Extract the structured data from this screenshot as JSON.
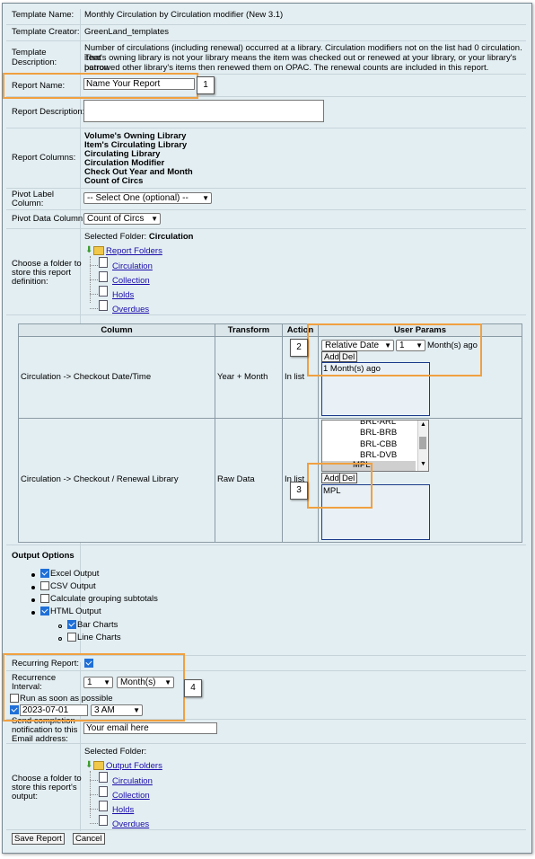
{
  "template_name": {
    "label": "Template Name:",
    "value": "Monthly Circulation by Circulation modifier (New 3.1)"
  },
  "template_creator": {
    "label": "Template Creator:",
    "value": "GreenLand_templates"
  },
  "template_description": {
    "label_line1": "Template",
    "label_line2": "Description:",
    "line1": "Number of circulations (including renewal) occurred at a library. Circulation modifiers not on the list had 0 circulation. That",
    "line2": "item's owning library is not your library means the item was checked out or renewed at your library, or your library's patron",
    "line3": "borrowed other library's items then renewed them on OPAC. The renewal counts are included in this report."
  },
  "report_name": {
    "label": "Report Name:",
    "value": "Name Your Report"
  },
  "report_description": {
    "label": "Report Description:"
  },
  "report_columns": {
    "label": "Report Columns:",
    "items": [
      "Volume's Owning Library",
      "Item's Circulating Library",
      "Circulating Library",
      "Circulation Modifier",
      "Check Out Year and Month",
      "Count of Circs"
    ]
  },
  "pivot_label": {
    "label_line1": "Pivot Label",
    "label_line2": "Column:",
    "value": "-- Select One (optional) --"
  },
  "pivot_data": {
    "label": "Pivot Data Column:",
    "value": "Count of Circs"
  },
  "folder": {
    "label_line1": "Choose a folder to",
    "label_line2": "store this report",
    "label_line3": "definition:",
    "selected_label": "Selected Folder:",
    "selected_value": "Circulation",
    "root": "Report Folders",
    "children": [
      "Circulation",
      "Collection",
      "Holds",
      "Overdues"
    ]
  },
  "params_table": {
    "headers": [
      "Column",
      "Transform",
      "Action",
      "User Params"
    ],
    "row1": {
      "column": "Circulation -> Checkout Date/Time",
      "transform": "Year + Month",
      "action": "In list",
      "date_mode": "Relative Date",
      "num": "1",
      "suffix": "Month(s) ago",
      "add": "Add",
      "del": "Del",
      "list_item": "1 Month(s) ago"
    },
    "row2": {
      "column": "Circulation -> Checkout / Renewal Library",
      "transform": "Raw Data",
      "action": "In list",
      "options": [
        "BRL-ARL",
        "BRL-BRB",
        "BRL-CBB",
        "BRL-DVB",
        "MPL"
      ],
      "add": "Add",
      "del": "Del",
      "list_item": "MPL"
    }
  },
  "output": {
    "title": "Output Options",
    "excel": "Excel Output",
    "csv": "CSV Output",
    "subtotals": "Calculate grouping subtotals",
    "html": "HTML Output",
    "bar": "Bar Charts",
    "line": "Line Charts"
  },
  "recurring": {
    "label": "Recurring Report:",
    "interval_label_line1": "Recurrence",
    "interval_label_line2": "Interval:",
    "interval_num": "1",
    "interval_unit": "Month(s)",
    "run_asap": "Run as soon as possible",
    "date": "2023-07-01",
    "time": "3 AM"
  },
  "email": {
    "label_line1": "Send completion",
    "label_line2": "notification to this",
    "label_line3": "Email address:",
    "value": "Your email here"
  },
  "output_folder": {
    "label_line1": "Choose a folder to",
    "label_line2": "store this report's",
    "label_line3": "output:",
    "selected_label": "Selected Folder:",
    "root": "Output Folders",
    "children": [
      "Circulation",
      "Collection",
      "Holds",
      "Overdues"
    ]
  },
  "buttons": {
    "save": "Save Report",
    "cancel": "Cancel"
  },
  "callouts": [
    "1",
    "2",
    "3",
    "4"
  ],
  "colors": {
    "callout": "#f0a040",
    "link": "#1a0dab",
    "background": "#e3eef2"
  }
}
